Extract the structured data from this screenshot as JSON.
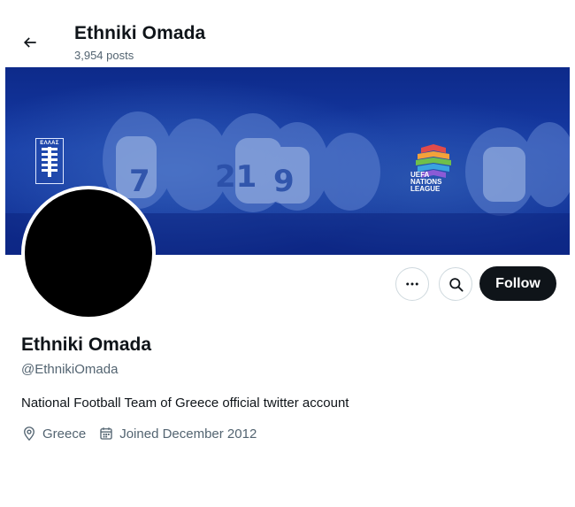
{
  "header": {
    "display_name": "Ethniki Omada",
    "posts_count": "3,954 posts",
    "back_icon": "arrow-left-icon"
  },
  "banner": {
    "flag_text": "ΕΛΛΑΣ",
    "competition_logo_text": "UEFA\nNATIONS\nLEAGUE",
    "colors": {
      "background": "#163ba6",
      "accent": "#ffffff"
    }
  },
  "profile": {
    "display_name": "Ethniki Omada",
    "handle": "@EthnikiOmada",
    "bio": "National Football Team of Greece official twitter account",
    "location": "Greece",
    "joined": "Joined December 2012"
  },
  "actions": {
    "more_icon": "more-dots-icon",
    "search_icon": "search-icon",
    "follow_label": "Follow"
  },
  "colors": {
    "primary_text": "#0f1419",
    "secondary_text": "#536471",
    "follow_button": "#0f1419",
    "border": "#cfd9de"
  }
}
